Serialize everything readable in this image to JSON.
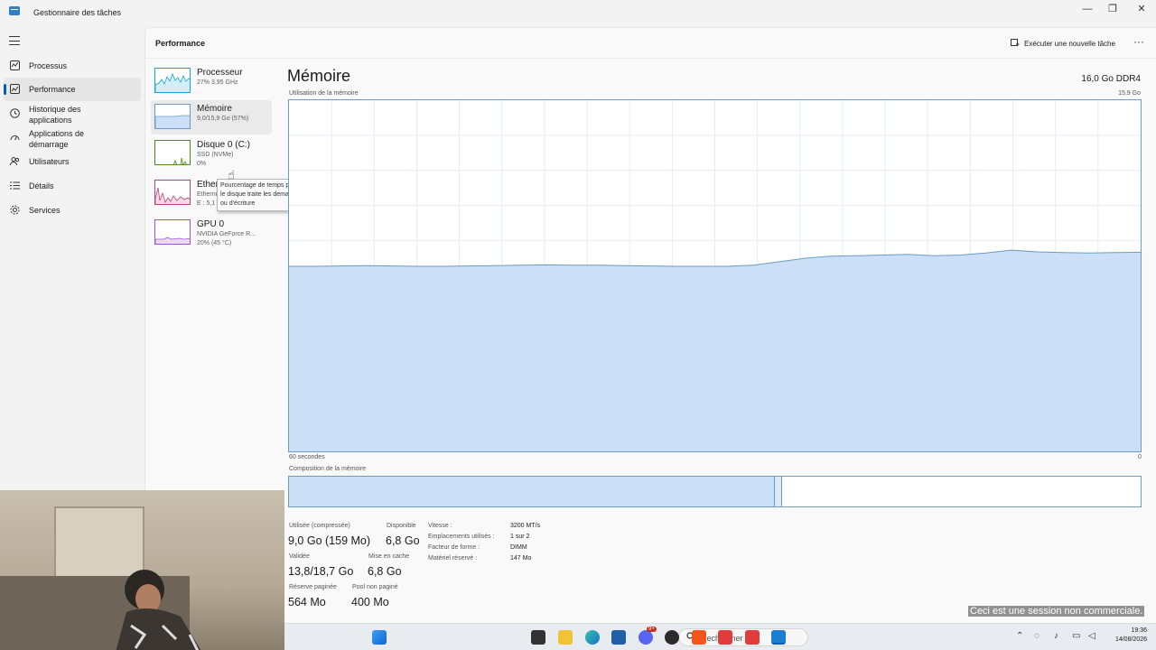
{
  "window": {
    "title": "Gestionnaire des tâches",
    "controls": {
      "minimize": "—",
      "maximize": "❐",
      "close": "✕"
    }
  },
  "nav": {
    "items": [
      {
        "label": "Processus",
        "icon": "processes-icon",
        "active": false
      },
      {
        "label": "Performance",
        "icon": "performance-icon",
        "active": true
      },
      {
        "label": "Historique des applications",
        "icon": "history-icon",
        "active": false
      },
      {
        "label": "Applications de démarrage",
        "icon": "startup-icon",
        "active": false
      },
      {
        "label": "Utilisateurs",
        "icon": "users-icon",
        "active": false
      },
      {
        "label": "Détails",
        "icon": "details-icon",
        "active": false
      },
      {
        "label": "Services",
        "icon": "services-icon",
        "active": false
      }
    ]
  },
  "header": {
    "title": "Performance",
    "run_task": "Exécuter une nouvelle tâche",
    "more": "···"
  },
  "resources": [
    {
      "name": "Processeur",
      "sub1": "27% 3,95 GHz",
      "sub2": "",
      "color": "#17a1d6",
      "fill": "#d2eef8"
    },
    {
      "name": "Mémoire",
      "sub1": "9,0/15,9 Go (57%)",
      "sub2": "",
      "color": "#6b9bc4",
      "fill": "#cbe0f6"
    },
    {
      "name": "Disque 0 (C:)",
      "sub1": "SSD (NVMe)",
      "sub2": "0%",
      "color": "#4d8a18",
      "fill": "#e2efd6"
    },
    {
      "name": "Ethernet",
      "sub1": "Ethernet",
      "sub2": "E : 5,1",
      "color": "#b3457a",
      "fill": "#f5d9e6"
    },
    {
      "name": "GPU 0",
      "sub1": "NVIDIA GeForce R...",
      "sub2": "20% (45 °C)",
      "color": "#9b54c9",
      "fill": "#ecd9f7"
    }
  ],
  "tooltip": {
    "text": "Pourcentage de temps pendant lequel le disque traite les demandes de lecture ou d'écriture"
  },
  "memory": {
    "title": "Mémoire",
    "spec": "16,0 Go DDR4",
    "usage_label": "Utilisation de la mémoire",
    "max_label": "15,9 Go",
    "time_label": "60 secondes",
    "zero_label": "0",
    "composition_label": "Composition de la mémoire",
    "composition": {
      "in_use_fraction": 0.57,
      "modified_fraction": 0.008
    },
    "usage_history_fraction": [
      0.527,
      0.527,
      0.528,
      0.529,
      0.528,
      0.527,
      0.527,
      0.528,
      0.529,
      0.53,
      0.531,
      0.53,
      0.53,
      0.529,
      0.528,
      0.527,
      0.527,
      0.527,
      0.53,
      0.54,
      0.55,
      0.556,
      0.557,
      0.559,
      0.561,
      0.557,
      0.559,
      0.565,
      0.573,
      0.568,
      0.566,
      0.565,
      0.566,
      0.567
    ],
    "stats": {
      "used_label": "Utilisée (compressée)",
      "used_value": "9,0 Go (159 Mo)",
      "available_label": "Disponible",
      "available_value": "6,8 Go",
      "committed_label": "Validée",
      "committed_value": "13,8/18,7 Go",
      "cached_label": "Mise en cache",
      "cached_value": "6,8 Go",
      "paged_label": "Réserve paginée",
      "paged_value": "564 Mo",
      "nonpaged_label": "Pool non paginé",
      "nonpaged_value": "400 Mo"
    },
    "properties": [
      {
        "label": "Vitesse :",
        "value": "3200 MT/s"
      },
      {
        "label": "Emplacements utilisés :",
        "value": "1 sur 2"
      },
      {
        "label": "Facteur de forme :",
        "value": "DIMM"
      },
      {
        "label": "Matériel réservé :",
        "value": "147 Mo"
      }
    ]
  },
  "watermark": "Ceci est une session non commerciale.",
  "taskbar": {
    "search_placeholder": "Rechercher",
    "apps": [
      "start-icon",
      "search-icon",
      "terminal-icon",
      "file-explorer-icon",
      "edge-icon",
      "store-icon",
      "discord-icon",
      "obs-icon",
      "brave-icon",
      "anydesk-icon",
      "anydesk-icon",
      "task-manager-icon"
    ],
    "discord_badge": "9+",
    "clock_time": "19:36",
    "clock_date": "14/08/2026"
  }
}
